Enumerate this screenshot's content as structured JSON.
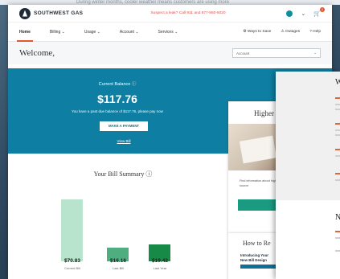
{
  "background_notice": "During winter months, cooler weather means customers are using more",
  "header": {
    "brand": "SOUTHWEST GAS",
    "leak_notice": "Suspect a leak? Call 911 and 877-860-6020",
    "profile_icon": "user-circle-icon",
    "cart_icon": "cart-icon",
    "cart_badge": "1"
  },
  "nav": {
    "items": [
      {
        "label": "Home"
      },
      {
        "label": "Billing ⌄"
      },
      {
        "label": "Usage ⌄"
      },
      {
        "label": "Account ⌄"
      },
      {
        "label": "Services ⌄"
      }
    ],
    "right": [
      {
        "label": "Ways to Save"
      },
      {
        "label": "Outages"
      },
      {
        "label": "Help"
      }
    ]
  },
  "welcome": {
    "title": "Welcome,",
    "account_select": "Account"
  },
  "balance": {
    "label": "Current Balance",
    "amount": "$117.76",
    "note": "You have a past due balance of $117.76, please pay now",
    "pay_button": "MAKE A PAYMENT",
    "view_bill": "View Bill"
  },
  "bill_summary": {
    "title": "Your Bill Summary"
  },
  "chart_data": {
    "type": "bar",
    "categories": [
      "Current Bill",
      "Last Bill",
      "Last Year"
    ],
    "values": [
      70.83,
      16.16,
      19.42
    ],
    "value_labels": [
      "$70.83",
      "$16.16",
      "$19.42"
    ],
    "colors": [
      "#b8e3cc",
      "#4fae7f",
      "#188a48"
    ],
    "title": "Your Bill Summary",
    "ylim": [
      0,
      72
    ]
  },
  "side_card": {
    "title": "Higher",
    "text": "Find information about higher cost and source",
    "button": "LEA"
  },
  "howto_card": {
    "title": "How to Re",
    "image_line1": "Introducing Your",
    "image_line2": "New Bill Design"
  },
  "overlay": {
    "heading1": "W",
    "heading2": "N"
  }
}
